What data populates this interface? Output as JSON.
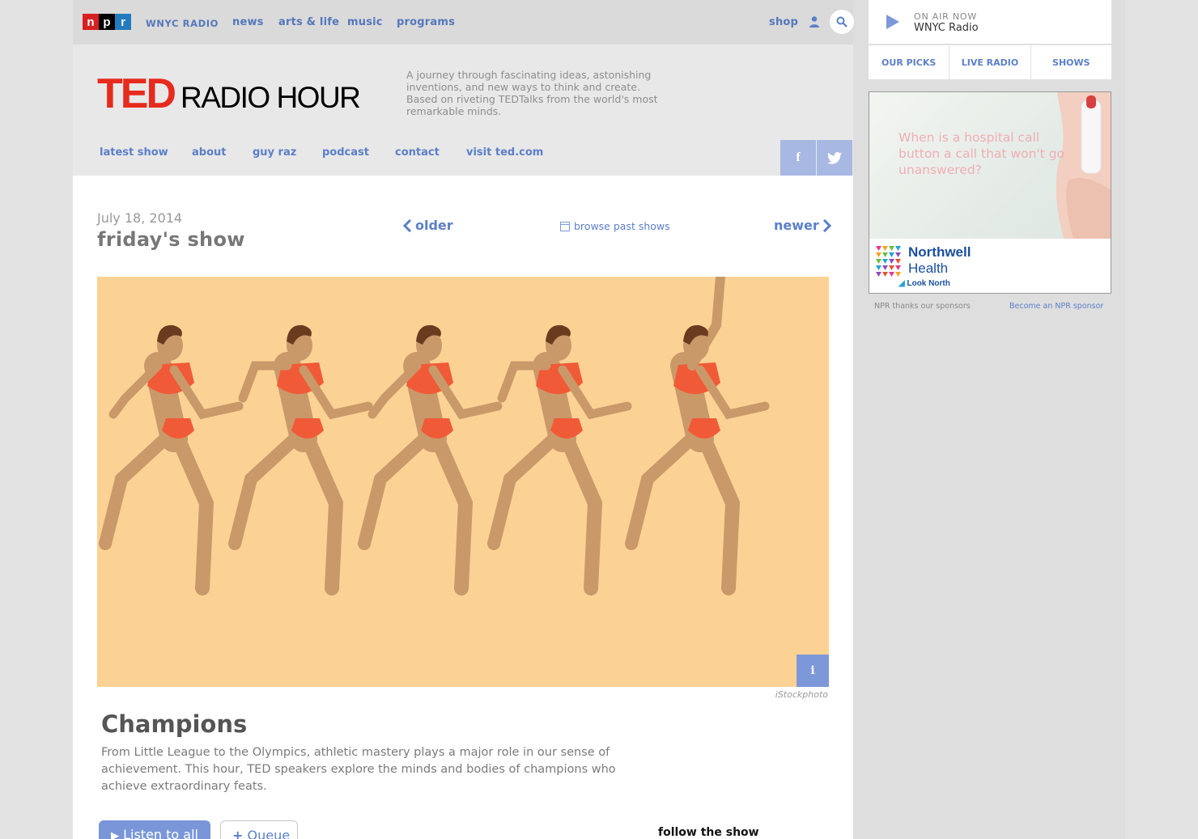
{
  "topnav": {
    "logo": {
      "n": "n",
      "p": "p",
      "r": "r"
    },
    "station": "WNYC RADIO",
    "items": [
      "news",
      "arts & life",
      "music",
      "programs"
    ],
    "shop": "shop"
  },
  "header": {
    "logo_ted": "TED",
    "logo_rest": "RADIO HOUR",
    "tagline": "A journey through fascinating ideas, astonishing inventions, and new ways to think and create. Based on riveting TEDTalks from the world's most remarkable minds.",
    "nav": [
      "latest show",
      "about",
      "guy raz",
      "podcast",
      "contact",
      "visit ted.com"
    ],
    "social": {
      "facebook": "f",
      "twitter": "t"
    }
  },
  "episode": {
    "date": "July 18, 2014",
    "title": "friday's show",
    "older": "older",
    "newer": "newer",
    "browse": "browse past shows"
  },
  "hero": {
    "credit": "iStockphoto",
    "info_label": "i",
    "figure_count": 5
  },
  "story": {
    "title": "Champions",
    "description": "From Little League to the Olympics, athletic mastery plays a major role in our sense of achievement. This hour, TED speakers explore the minds and bodies of champions who achieve extraordinary feats.",
    "listen_label": "Listen to all",
    "queue_label": "Queue",
    "follow_label": "follow the show"
  },
  "rail": {
    "onair_label": "ON AIR NOW",
    "onair_station": "WNYC Radio",
    "tabs": [
      "OUR PICKS",
      "LIVE RADIO",
      "SHOWS"
    ],
    "ad": {
      "headline": "When is a hospital call button a call that won't go unanswered?",
      "brand_line1": "Northwell",
      "brand_line2": "Health",
      "tagline": "Look North"
    },
    "sponsor_thanks": "NPR thanks our sponsors",
    "sponsor_link": "Become an NPR sponsor"
  },
  "colors": {
    "accent": "#5b7fc9",
    "ted_red": "#e62b1e",
    "hero_bg": "#fcd294",
    "suit": "#f15a37",
    "skin": "#c9996a"
  }
}
